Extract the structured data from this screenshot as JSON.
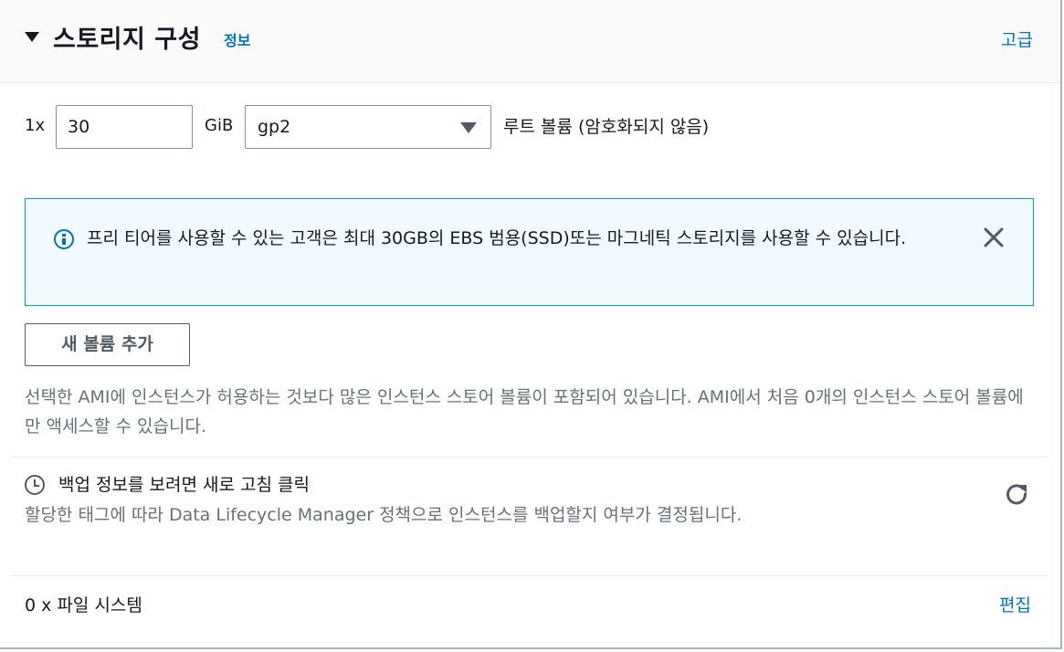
{
  "header": {
    "title": "스토리지 구성",
    "info_link": "정보",
    "advanced_link": "고급"
  },
  "root_volume": {
    "count": "1x",
    "size_value": "30",
    "size_unit": "GiB",
    "volume_type": "gp2",
    "description": "루트 볼륨  (암호화되지 않음)"
  },
  "free_tier_alert": {
    "text": "프리 티어를 사용할 수 있는 고객은 최대 30GB의 EBS 범용(SSD)또는 마그네틱 스토리지를 사용할 수 있습니다."
  },
  "add_volume_button": "새 볼륨 추가",
  "ami_note": "선택한 AMI에 인스턴스가 허용하는 것보다 많은 인스턴스 스토어 볼륨이 포함되어 있습니다. AMI에서 처음 0개의 인스턴스 스토어 볼륨에만 액세스할 수 있습니다.",
  "backup": {
    "title": "백업 정보를 보려면 새로 고침 클릭",
    "description": "할당한 태그에 따라 Data Lifecycle Manager 정책으로 인스턴스를 백업할지 여부가 결정됩니다."
  },
  "file_systems": {
    "label": "0 x 파일 시스템",
    "edit_link": "편집"
  },
  "colors": {
    "link": "#0073bb",
    "alert_border": "#00a1c9",
    "alert_bg": "#f1faff",
    "muted_text": "#687078"
  }
}
